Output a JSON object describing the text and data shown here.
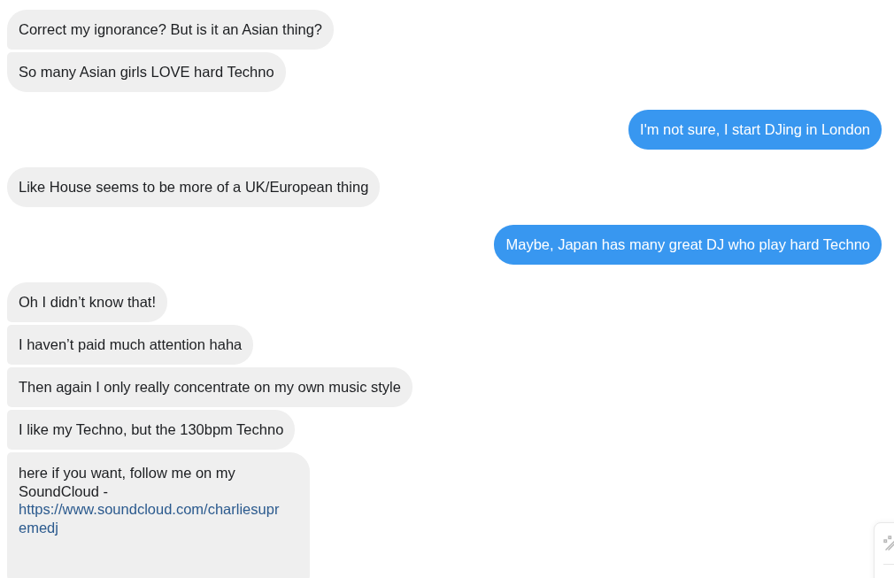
{
  "messages": [
    {
      "kind": "received",
      "text": "Correct my ignorance? But is it an Asian thing?"
    },
    {
      "kind": "received",
      "text": "So many Asian girls LOVE hard Techno"
    },
    {
      "kind": "sent",
      "text": "I'm not sure, I start DJing in London"
    },
    {
      "kind": "received",
      "text": "Like House seems to be more of a UK/European thing"
    },
    {
      "kind": "sent",
      "text": "Maybe, Japan has many great DJ who play hard Techno"
    },
    {
      "kind": "received",
      "text": "Oh I didn’t know that!"
    },
    {
      "kind": "received",
      "text": "I haven’t paid much attention haha"
    },
    {
      "kind": "received",
      "text": "Then again I only really concentrate on my own music style"
    },
    {
      "kind": "received",
      "text": "I like my Techno, but the 130bpm Techno"
    },
    {
      "kind": "received",
      "text": "here if you want, follow me on my SoundCloud -",
      "link": "https://www.soundcloud.com/charliesupremedj"
    }
  ]
}
